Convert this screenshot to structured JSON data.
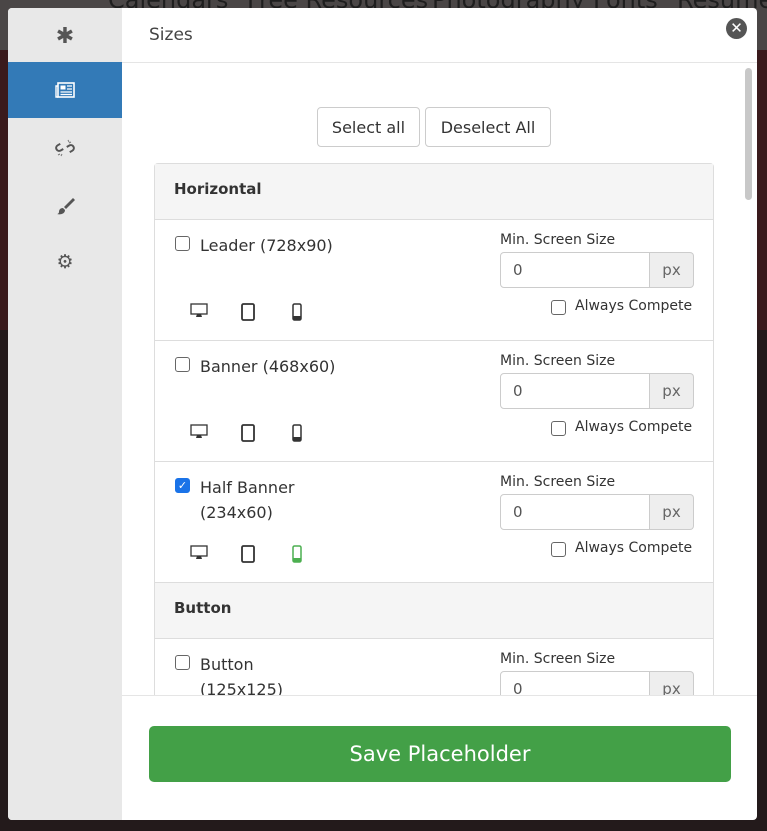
{
  "background_nav": [
    "Calendars",
    "Free Resources",
    "Photography",
    "Fonts",
    "Resume"
  ],
  "sidebar": {
    "items": [
      {
        "icon": "asterisk-icon"
      },
      {
        "icon": "newspaper-icon",
        "active": true
      },
      {
        "icon": "unlink-icon"
      },
      {
        "icon": "paintbrush-icon"
      },
      {
        "icon": "gear-icon"
      }
    ]
  },
  "header": {
    "title": "Sizes",
    "close_icon": "close-circle-icon"
  },
  "actions": {
    "select_all": "Select all",
    "deselect_all": "Deselect All"
  },
  "groups": [
    {
      "name": "Horizontal",
      "sizes": [
        {
          "label": "Leader (728x90)",
          "checked": false,
          "min_label": "Min. Screen Size",
          "min_value": "0",
          "unit": "px",
          "always_compete": "Always Compete",
          "always_checked": false,
          "mobile_active": false
        },
        {
          "label": "Banner (468x60)",
          "checked": false,
          "min_label": "Min. Screen Size",
          "min_value": "0",
          "unit": "px",
          "always_compete": "Always Compete",
          "always_checked": false,
          "mobile_active": false
        },
        {
          "label": "Half Banner (234x60)",
          "checked": true,
          "min_label": "Min. Screen Size",
          "min_value": "0",
          "unit": "px",
          "always_compete": "Always Compete",
          "always_checked": false,
          "mobile_active": true
        }
      ]
    },
    {
      "name": "Button",
      "sizes": [
        {
          "label": "Button (125x125)",
          "checked": false,
          "min_label": "Min. Screen Size",
          "min_value": "0",
          "unit": "px"
        }
      ]
    }
  ],
  "footer": {
    "save": "Save Placeholder"
  },
  "colors": {
    "active": "#337ab7",
    "save": "#43a047",
    "mobile_active": "#4caf50",
    "checkbox": "#1a73e8"
  }
}
